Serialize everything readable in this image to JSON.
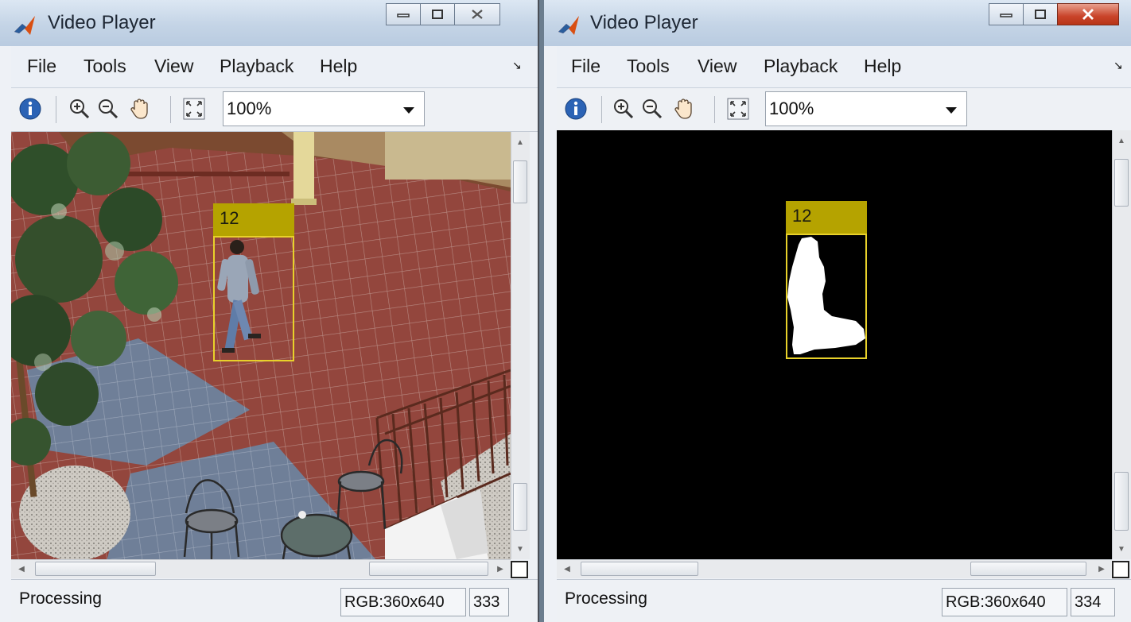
{
  "windows": [
    {
      "title": "Video Player",
      "menu": [
        "File",
        "Tools",
        "View",
        "Playback",
        "Help"
      ],
      "zoom": "100%",
      "status": {
        "text": "Processing",
        "format": "RGB:360x640",
        "frame": "333"
      },
      "track": {
        "label": "12"
      },
      "view": "color-frame"
    },
    {
      "title": "Video Player",
      "menu": [
        "File",
        "Tools",
        "View",
        "Playback",
        "Help"
      ],
      "zoom": "100%",
      "status": {
        "text": "Processing",
        "format": "RGB:360x640",
        "frame": "334"
      },
      "track": {
        "label": "12"
      },
      "view": "foreground-mask"
    }
  ],
  "icons": [
    "matlab-logo-icon",
    "minimize-icon",
    "maximize-icon",
    "close-icon",
    "info-icon",
    "zoom-in-icon",
    "zoom-out-icon",
    "pan-hand-icon",
    "fit-to-window-icon",
    "menu-dock-arrow-icon"
  ],
  "colors": {
    "track_label_bg": "#b5a300",
    "track_box": "#e8d12a",
    "mask_bg": "#000000",
    "mask_fg": "#ffffff"
  }
}
